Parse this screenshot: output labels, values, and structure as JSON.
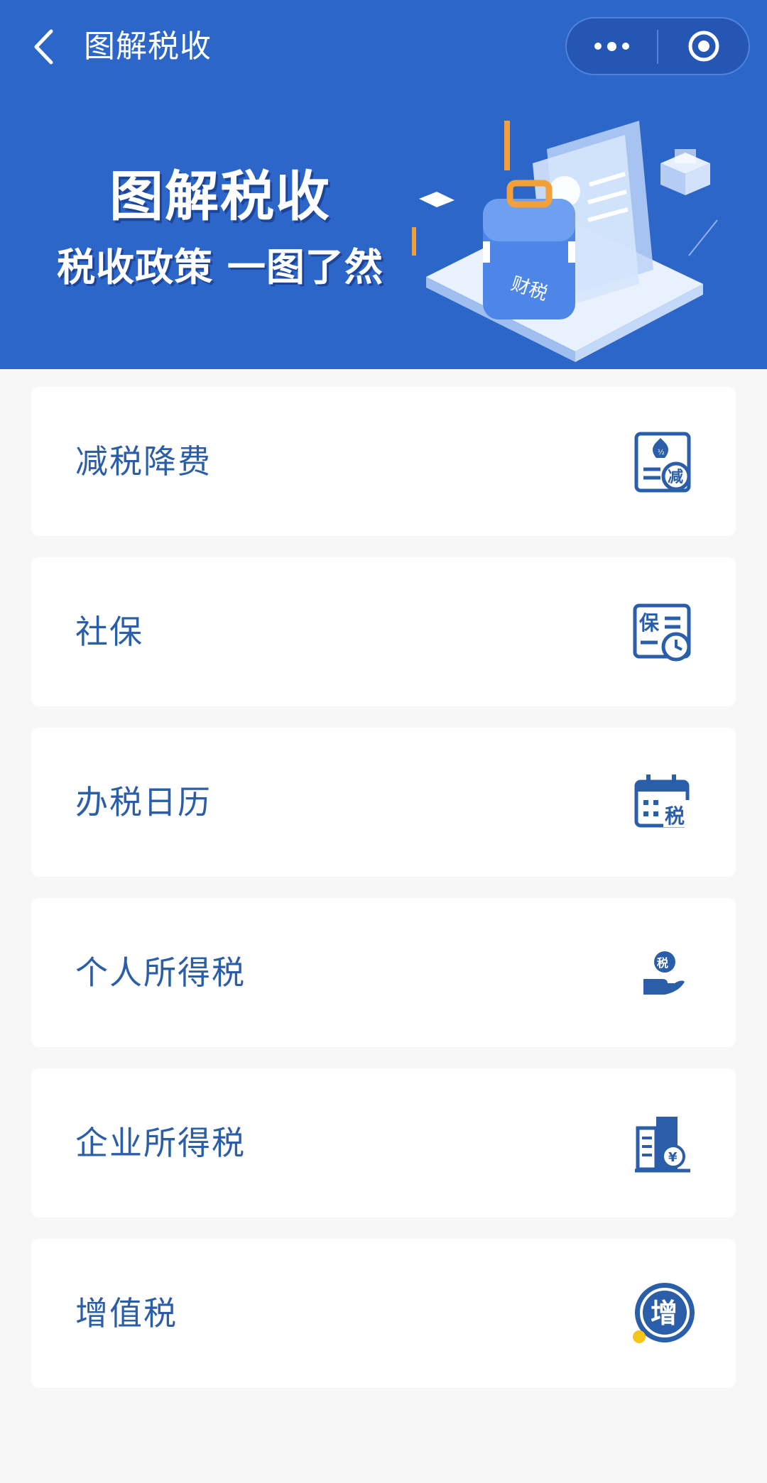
{
  "header": {
    "title": "图解税收",
    "back_icon": "chevron-left-icon",
    "more_icon": "more-dots-icon",
    "close_icon": "target-circle-icon",
    "background_color": "#2d66c9"
  },
  "banner": {
    "title": "图解税收",
    "subtitle": "税收政策 一图了然",
    "illustration_label": "财税"
  },
  "menu": {
    "items": [
      {
        "label": "减税降费",
        "icon": "tax-reduction-icon",
        "icon_text": "减"
      },
      {
        "label": "社保",
        "icon": "social-security-icon",
        "icon_text": "保"
      },
      {
        "label": "办税日历",
        "icon": "tax-calendar-icon",
        "icon_text": "税"
      },
      {
        "label": "个人所得税",
        "icon": "personal-income-tax-icon",
        "icon_text": "税"
      },
      {
        "label": "企业所得税",
        "icon": "corporate-income-tax-icon",
        "icon_text": "¥"
      },
      {
        "label": "增值税",
        "icon": "vat-icon",
        "icon_text": "增"
      }
    ]
  },
  "colors": {
    "accent": "#2b5ea8",
    "page_background": "#f7f7f7",
    "card_background": "#ffffff",
    "highlight_yellow": "#f5c518"
  }
}
